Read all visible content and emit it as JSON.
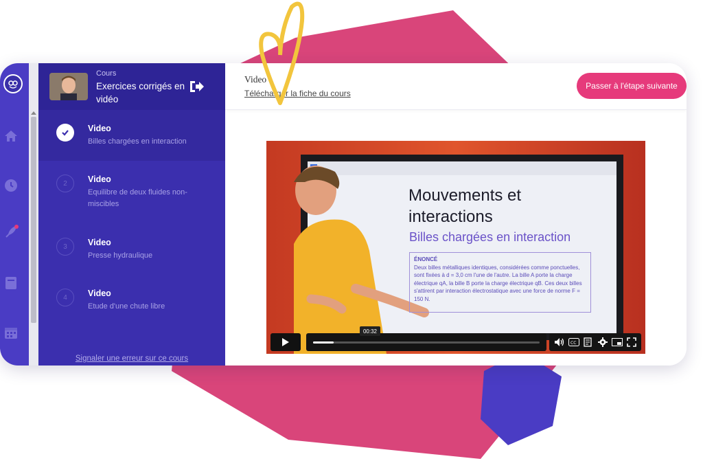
{
  "sidebar": {
    "kicker": "Cours",
    "course_title": "Exercices corrigés en vidéo",
    "report_link": "Signaler une erreur sur ce cours",
    "lessons": [
      {
        "number": "",
        "status": "done",
        "title": "Video",
        "subtitle": "Billes chargées en interaction"
      },
      {
        "number": "2",
        "status": "todo",
        "title": "Video",
        "subtitle": "Equilibre de deux fluides non-miscibles"
      },
      {
        "number": "3",
        "status": "todo",
        "title": "Video",
        "subtitle": "Presse hydraulique"
      },
      {
        "number": "4",
        "status": "todo",
        "title": "Video",
        "subtitle": "Etude d'une chute libre"
      }
    ]
  },
  "header": {
    "section_label": "Video",
    "download_link": "Télécharger la fiche du cours",
    "next_button": "Passer à l'étape suivante"
  },
  "video": {
    "slide_title": "Mouvements et interactions",
    "slide_subtitle": "Billes chargées en interaction",
    "enonce_label": "ÉNONCÉ",
    "enonce_text": "Deux billes métalliques identiques, considérées comme ponctuelles, sont fixées à d = 3,0 cm l'une de l'autre. La bille A porte la charge électrique qA, la bille B porte la charge électrique qB. Ces deux billes s'attirent par interaction électrostatique avec une force de norme F = 150 N.",
    "current_time": "00:32",
    "progress_fraction": 0.09
  },
  "colors": {
    "rail": "#4a3cc4",
    "sidebar": "#3b2fae",
    "accent": "#e63a7b",
    "deco_pink": "#d9457a",
    "deco_blue": "#4a3cc4",
    "deco_yellow": "#f2c53d"
  }
}
